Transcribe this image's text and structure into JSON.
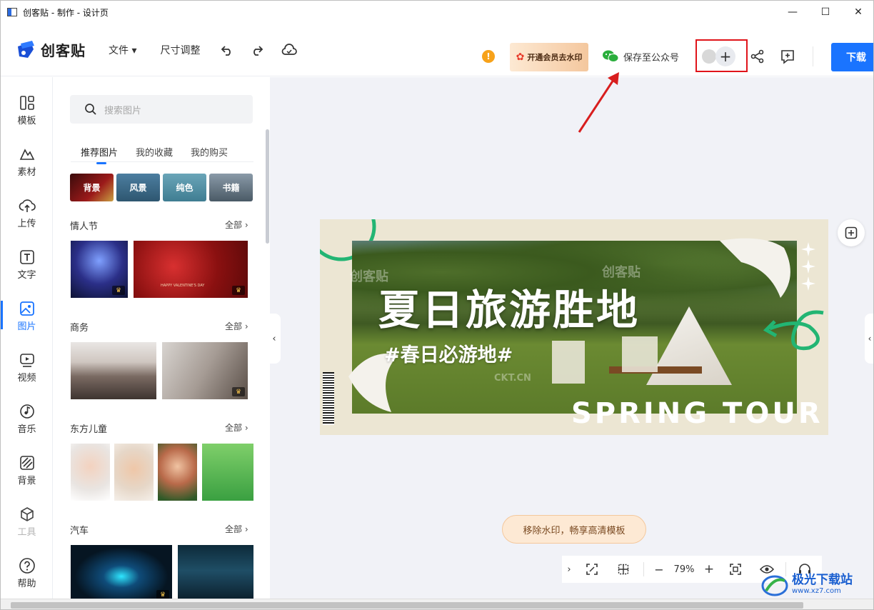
{
  "window": {
    "title": "创客贴 - 制作 - 设计页",
    "minimize": "—",
    "maximize": "☐",
    "close": "✕"
  },
  "header": {
    "logo_text": "创客贴",
    "menu": {
      "file": "文件 ▾",
      "resize": "尺寸调整"
    },
    "vip_label": "开通会员去水印",
    "wechat_label": "保存至公众号",
    "download_label": "下载",
    "warn": "!",
    "plus": "+"
  },
  "leftnav": {
    "items": [
      {
        "label": "模板",
        "icon": "template-icon"
      },
      {
        "label": "素材",
        "icon": "material-icon"
      },
      {
        "label": "上传",
        "icon": "upload-icon"
      },
      {
        "label": "文字",
        "icon": "text-icon"
      },
      {
        "label": "图片",
        "icon": "image-icon"
      },
      {
        "label": "视频",
        "icon": "video-icon"
      },
      {
        "label": "音乐",
        "icon": "music-icon"
      },
      {
        "label": "背景",
        "icon": "background-icon"
      },
      {
        "label": "工具",
        "icon": "tools-icon"
      },
      {
        "label": "帮助",
        "icon": "help-icon"
      }
    ],
    "active_index": 4
  },
  "panel": {
    "search_placeholder": "搜索图片",
    "tabs": [
      "推荐图片",
      "我的收藏",
      "我的购买"
    ],
    "categories": [
      "背景",
      "风景",
      "纯色",
      "书籍"
    ],
    "more_label": "全部 ›",
    "sections": [
      "情人节",
      "商务",
      "东方儿童",
      "汽车"
    ],
    "thumb_text": {
      "valentine": "HAPPY VALENTINE'S DAY"
    }
  },
  "design": {
    "heading": "夏日旅游胜地",
    "subheading": "#春日必游地#",
    "english_title": "SPRING TOUR",
    "watermark_cn": "创客贴",
    "watermark_en": "CKT.CN"
  },
  "canvas": {
    "watermark_pill": "移除水印，畅享高清模板",
    "zoom": "79%",
    "zoom_minus": "−",
    "zoom_plus": "+"
  },
  "site_watermark": {
    "name": "极光下载站",
    "url": "www.xz7.com"
  },
  "colors": {
    "accent": "#1a74ff",
    "highlight_box": "#e0141a",
    "arrow": "#d81e1e"
  }
}
